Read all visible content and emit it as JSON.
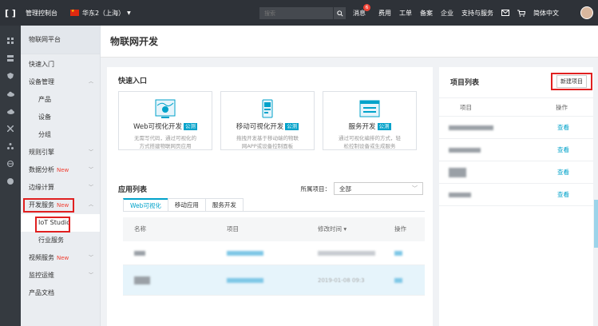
{
  "topbar": {
    "console": "管理控制台",
    "region": "华东2（上海）",
    "search_placeholder": "搜索",
    "nav": [
      "消息",
      "费用",
      "工单",
      "备案",
      "企业",
      "支持与服务",
      "简体中文"
    ],
    "message_count": "6"
  },
  "sidebar": {
    "title": "物联网平台",
    "items": [
      {
        "label": "快速入门"
      },
      {
        "label": "设备管理"
      },
      {
        "label": "产品",
        "sub": true
      },
      {
        "label": "设备",
        "sub": true
      },
      {
        "label": "分组",
        "sub": true
      },
      {
        "label": "规则引擎"
      },
      {
        "label": "数据分析",
        "new": "New"
      },
      {
        "label": "边缘计算"
      },
      {
        "label": "开发服务",
        "new": "New"
      },
      {
        "label": "IoT Studio",
        "sub": true
      },
      {
        "label": "行业服务",
        "sub": true
      },
      {
        "label": "视频服务",
        "new": "New"
      },
      {
        "label": "监控运维"
      },
      {
        "label": "产品文档"
      }
    ]
  },
  "page": {
    "title": "物联网开发"
  },
  "quick_entry": {
    "title": "快速入口",
    "cards": [
      {
        "title": "Web可视化开发",
        "tag": "公测",
        "desc": [
          "无需写代码，通过可视化的",
          "方式搭建物联网页应用"
        ]
      },
      {
        "title": "移动可视化开发",
        "tag": "公测",
        "desc": [
          "拖拽开发基于移动端的物联",
          "网APP或设备控制面板"
        ]
      },
      {
        "title": "服务开发",
        "tag": "公测",
        "desc": [
          "通过可视化编排的方式，轻",
          "松控制设备或生成服务"
        ]
      }
    ]
  },
  "app_list": {
    "title": "应用列表",
    "filter_label": "所属项目：",
    "filter_value": "全部",
    "tabs": [
      "Web可视化",
      "移动应用",
      "服务开发"
    ],
    "columns": [
      "名称",
      "项目",
      "修改时间 ▾",
      "操作"
    ],
    "row2_time": "2019-01-08 09:3"
  },
  "project_list": {
    "title": "项目列表",
    "new_button": "新建项目",
    "columns": [
      "项目",
      "操作"
    ],
    "view_label": "查看"
  },
  "colors": {
    "accent": "#00a2ca",
    "topbar": "#2e3238",
    "highlight": "#e02020"
  }
}
